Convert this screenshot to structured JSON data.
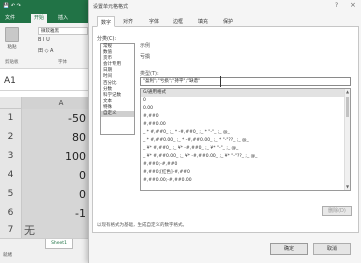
{
  "excel": {
    "tabs": [
      "文件",
      "开始",
      "插入"
    ],
    "ribbon": {
      "paste_label": "粘贴",
      "font_name": "微软雅黑",
      "format_row1": "B I U",
      "format_row2": "田 ◇ A",
      "clipboard_group": "剪贴板",
      "font_group": "字体"
    },
    "name_box": "A1",
    "column_header": "A",
    "rows": [
      {
        "num": "1",
        "value": "-50"
      },
      {
        "num": "2",
        "value": "80"
      },
      {
        "num": "3",
        "value": "100"
      },
      {
        "num": "4",
        "value": "0"
      },
      {
        "num": "5",
        "value": "0"
      },
      {
        "num": "6",
        "value": "-1"
      },
      {
        "num": "7",
        "value": "无"
      },
      {
        "num": "8",
        "value": ""
      }
    ],
    "sheet_tab": "Sheet1",
    "status": "就绪"
  },
  "dialog": {
    "title": "设置单元格格式",
    "help": "?",
    "close": "×",
    "tabs": [
      "数字",
      "对齐",
      "字体",
      "边框",
      "填充",
      "保护"
    ],
    "category_label": "分类(C):",
    "categories": [
      "常规",
      "数值",
      "货币",
      "会计专用",
      "日期",
      "时间",
      "百分比",
      "分数",
      "科学记数",
      "文本",
      "特殊",
      "自定义"
    ],
    "selected_category_index": 11,
    "sample_label": "示例",
    "sample_value": "亏损",
    "type_label": "类型(T):",
    "type_value": "\"盈利\";\"亏损\";\"持平\";\"缺谱\"",
    "formats": [
      "G/通用格式",
      "0",
      "0.00",
      "#,##0",
      "#,##0.00",
      "_ * #,##0_ ;_ * -#,##0_ ;_ * \"-\"_ ;_ @_",
      "_ * #,##0.00_ ;_ * -#,##0.00_ ;_ * \"-\"??_ ;_ @_",
      "_ ¥* #,##0_ ;_ ¥* -#,##0_ ;_ ¥* \"-\"_ ;_ @_",
      "_ ¥* #,##0.00_ ;_ ¥* -#,##0.00_ ;_ ¥* \"-\"??_ ;_ @_",
      "#,##0;-#,##0",
      "#,##0;[红色]-#,##0",
      "#,##0.00;-#,##0.00"
    ],
    "delete_button": "删除(D)",
    "hint": "以现有格式为基础，生成自定义的数字格式。",
    "ok_button": "确定",
    "cancel_button": "取消"
  }
}
